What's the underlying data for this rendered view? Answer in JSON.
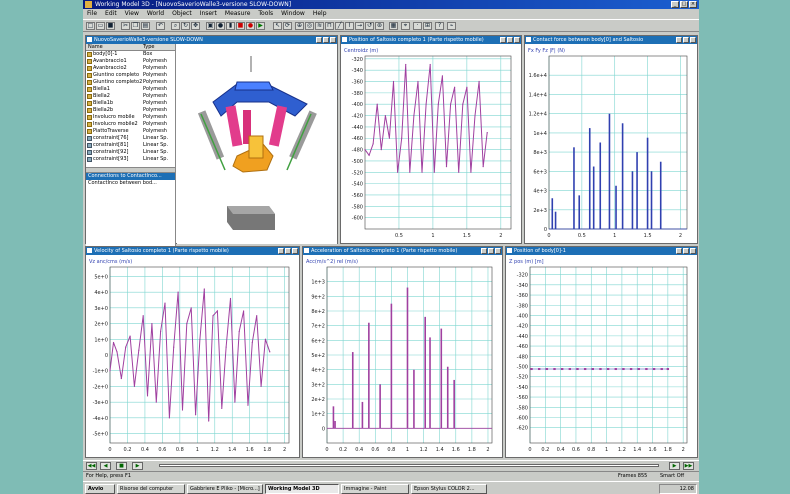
{
  "app": {
    "title": "Working Model 3D - [NuovoSaverioWalle3-versione SLOW-DOWN]",
    "menu": [
      "File",
      "Edit",
      "View",
      "World",
      "Object",
      "Insert",
      "Measure",
      "Tools",
      "Window",
      "Help"
    ]
  },
  "tree_window": {
    "title": "NuovoSaverioWalle3-versione SLOW-DOWN",
    "col_name": "Name",
    "col_type": "Type",
    "items": [
      {
        "name": "body[0]-1",
        "type": "Box"
      },
      {
        "name": "Avanbraccio1",
        "type": "Polymesh"
      },
      {
        "name": "Avanbraccio2",
        "type": "Polymesh"
      },
      {
        "name": "Giuntino completo",
        "type": "Polymesh"
      },
      {
        "name": "Giuntino completo2",
        "type": "Polymesh"
      },
      {
        "name": "Biella1",
        "type": "Polymesh"
      },
      {
        "name": "Biella2",
        "type": "Polymesh"
      },
      {
        "name": "Biella1b",
        "type": "Polymesh"
      },
      {
        "name": "Biella2b",
        "type": "Polymesh"
      },
      {
        "name": "Involucro mobile",
        "type": "Polymesh"
      },
      {
        "name": "Involucro mobile2",
        "type": "Polymesh"
      },
      {
        "name": "PiattoTraverse",
        "type": "Polymesh"
      },
      {
        "name": "constraint[76]",
        "type": "Linear Sp."
      },
      {
        "name": "constraint[81]",
        "type": "Linear Sp."
      },
      {
        "name": "constraint[92]",
        "type": "Linear Sp."
      },
      {
        "name": "constraint[93]",
        "type": "Linear Sp."
      }
    ],
    "sub_title": "Connections to ContactInco...",
    "sub_item": "ContactInco between bod..."
  },
  "status": {
    "left": "For Help, press F1",
    "frames": "Frames 855",
    "smart": "Smart Off"
  },
  "taskbar": {
    "items": [
      {
        "label": "Avvio",
        "active": false,
        "start": true
      },
      {
        "label": "Risorse del computer",
        "active": false
      },
      {
        "label": "Gabbriere E Pliko - [Micro...]",
        "active": false
      },
      {
        "label": "Working Model 3D",
        "active": true
      },
      {
        "label": "Immagine - Paint",
        "active": false
      },
      {
        "label": "Epson Stylus COLOR 2...",
        "active": false
      }
    ],
    "clock": "12.08"
  },
  "chart_data": [
    {
      "type": "line",
      "title": "Position of Saltosio completo 1 (Parte rispetto mobile)",
      "ylabel": "Centroidz (m)",
      "color": "#a040a0",
      "ylim": [
        -0.62,
        -0.315
      ],
      "yticks": [
        -0.32,
        -0.34,
        -0.36,
        -0.38,
        -0.4,
        -0.42,
        -0.44,
        -0.46,
        -0.48,
        -0.5,
        -0.52,
        -0.54,
        -0.56,
        -0.58,
        -0.6
      ],
      "yticklabels": [
        "-320",
        "-340",
        "-360",
        "-380",
        "-400",
        "-420",
        "-440",
        "-460",
        "-480",
        "-500",
        "-520",
        "-540",
        "-560",
        "-580",
        "-600"
      ],
      "xlim": [
        0,
        2.15
      ],
      "xticks": [
        0.5,
        1.0,
        1.5,
        2.0
      ],
      "xticklabels": [
        "0.5",
        "1",
        "1.5",
        "2"
      ],
      "x": [
        0,
        0.06,
        0.12,
        0.18,
        0.24,
        0.3,
        0.36,
        0.42,
        0.48,
        0.54,
        0.6,
        0.66,
        0.72,
        0.78,
        0.84,
        0.9,
        0.96,
        1.02,
        1.08,
        1.14,
        1.2,
        1.26,
        1.32,
        1.38,
        1.44,
        1.5,
        1.56,
        1.62,
        1.68,
        1.74,
        1.8
      ],
      "y": [
        -0.48,
        -0.49,
        -0.47,
        -0.4,
        -0.48,
        -0.42,
        -0.46,
        -0.36,
        -0.52,
        -0.46,
        -0.33,
        -0.52,
        -0.42,
        -0.36,
        -0.52,
        -0.4,
        -0.33,
        -0.52,
        -0.4,
        -0.35,
        -0.51,
        -0.4,
        -0.37,
        -0.52,
        -0.4,
        -0.37,
        -0.52,
        -0.42,
        -0.36,
        -0.51,
        -0.45
      ]
    },
    {
      "type": "bar",
      "title": "Contact force between body[0] and Saltosio",
      "ylabel": "Fx  Fy  Fz  |F| (N)",
      "color": "#3040b0",
      "ylim": [
        0,
        18000
      ],
      "yticks": [
        0,
        2000,
        4000,
        6000,
        8000,
        10000,
        12000,
        14000,
        16000
      ],
      "yticklabels": [
        "0",
        "2e+3",
        "4e+3",
        "6e+3",
        "8e+3",
        "1e+4",
        "1.2e+4",
        "1.4e+4",
        "1.6e+4"
      ],
      "xlim": [
        0,
        2.1
      ],
      "xticks": [
        0,
        0.5,
        1.0,
        1.5,
        2.0
      ],
      "xticklabels": [
        "0",
        "0.5",
        "1",
        "1.5",
        "2"
      ],
      "x": [
        0.05,
        0.1,
        0.38,
        0.46,
        0.62,
        0.68,
        0.78,
        0.92,
        1.02,
        1.12,
        1.27,
        1.34,
        1.5,
        1.56,
        1.7
      ],
      "values": [
        3200,
        1800,
        8500,
        3500,
        10500,
        6500,
        9000,
        12000,
        4500,
        11000,
        6000,
        8000,
        9500,
        6000,
        7000
      ]
    },
    {
      "type": "line",
      "title": "Velocity of Saltosio completo 1 (Parte rispetto mobile)",
      "ylabel": "Vz anc/cms (m/s)",
      "color": "#a040a0",
      "ylim": [
        -5.6,
        5.6
      ],
      "yticks": [
        -5,
        -4,
        -3,
        -2,
        -1,
        0,
        1,
        2,
        3,
        4,
        5
      ],
      "yticklabels": [
        "-5e+0",
        "-4e+0",
        "-3e+0",
        "-2e+0",
        "-1e+0",
        "0",
        "1e+0",
        "2e+0",
        "3e+0",
        "4e+0",
        "5e+0"
      ],
      "xlim": [
        0,
        2.05
      ],
      "xticks": [
        0,
        0.2,
        0.4,
        0.6,
        0.8,
        1.0,
        1.2,
        1.4,
        1.6,
        1.8,
        2.0
      ],
      "xticklabels": [
        "0",
        "0.2",
        "0.4",
        "0.6",
        "0.8",
        "1",
        "1.2",
        "1.4",
        "1.6",
        "1.8",
        "2"
      ],
      "x": [
        0,
        0.04,
        0.08,
        0.13,
        0.18,
        0.23,
        0.28,
        0.33,
        0.38,
        0.43,
        0.48,
        0.53,
        0.58,
        0.63,
        0.68,
        0.73,
        0.78,
        0.83,
        0.88,
        0.93,
        0.98,
        1.03,
        1.08,
        1.13,
        1.18,
        1.23,
        1.28,
        1.33,
        1.38,
        1.43,
        1.48,
        1.53,
        1.58,
        1.63,
        1.68,
        1.73,
        1.78,
        1.83
      ],
      "y": [
        -1.0,
        0.8,
        0.2,
        -1.5,
        0.5,
        1.2,
        -2.0,
        0.3,
        2.5,
        -2.6,
        2.0,
        -3.0,
        1.5,
        3.3,
        -4.0,
        0.5,
        4.0,
        -3.5,
        2.0,
        3.0,
        -3.8,
        1.0,
        4.2,
        -4.2,
        2.5,
        2.8,
        -3.4,
        0.5,
        3.6,
        -3.0,
        1.5,
        2.8,
        -3.2,
        0.8,
        2.5,
        -2.0,
        1.0,
        0.2
      ]
    },
    {
      "type": "bar",
      "title": "Acceleration of Saltosio completo 1 (Parte rispetto mobile)",
      "ylabel": "Acc(m/s^2) rel (m/s)",
      "color": "#a040a0",
      "ylim": [
        -100,
        1100
      ],
      "yticks": [
        0,
        100,
        200,
        300,
        400,
        500,
        600,
        700,
        800,
        900,
        1000
      ],
      "yticklabels": [
        "0",
        "1e+2",
        "2e+2",
        "3e+2",
        "4e+2",
        "5e+2",
        "6e+2",
        "7e+2",
        "8e+2",
        "9e+2",
        "1e+3"
      ],
      "xlim": [
        0,
        2.05
      ],
      "xticks": [
        0,
        0.2,
        0.4,
        0.6,
        0.8,
        1.0,
        1.2,
        1.4,
        1.6,
        1.8,
        2.0
      ],
      "xticklabels": [
        "0",
        "0.2",
        "0.4",
        "0.6",
        "0.8",
        "1",
        "1.2",
        "1.4",
        "1.6",
        "1.8",
        "2"
      ],
      "x": [
        0.08,
        0.1,
        0.32,
        0.44,
        0.52,
        0.66,
        0.8,
        1.0,
        1.08,
        1.22,
        1.28,
        1.42,
        1.5,
        1.58
      ],
      "values": [
        150,
        50,
        520,
        180,
        720,
        300,
        850,
        960,
        400,
        760,
        620,
        680,
        420,
        330
      ]
    },
    {
      "type": "scatter",
      "title": "Position of body[0]-1",
      "ylabel": "Z pos (m) [m]",
      "color": "#3040b0",
      "ylim": [
        -0.65,
        -0.305
      ],
      "yticks": [
        -0.32,
        -0.34,
        -0.36,
        -0.38,
        -0.4,
        -0.42,
        -0.44,
        -0.46,
        -0.48,
        -0.5,
        -0.52,
        -0.54,
        -0.56,
        -0.58,
        -0.6,
        -0.62
      ],
      "yticklabels": [
        "-320",
        "-340",
        "-360",
        "-380",
        "-400",
        "-420",
        "-440",
        "-460",
        "-480",
        "-500",
        "-520",
        "-540",
        "-560",
        "-580",
        "-600",
        "-620"
      ],
      "xlim": [
        0,
        2.05
      ],
      "xticks": [
        0,
        0.2,
        0.4,
        0.6,
        0.8,
        1.0,
        1.2,
        1.4,
        1.6,
        1.8,
        2.0
      ],
      "xticklabels": [
        "0",
        "0.2",
        "0.4",
        "0.6",
        "0.8",
        "1",
        "1.2",
        "1.4",
        "1.6",
        "1.8",
        "2"
      ],
      "x": [
        0.02,
        0.12,
        0.22,
        0.32,
        0.42,
        0.52,
        0.62,
        0.72,
        0.82,
        0.92,
        1.02,
        1.12,
        1.22,
        1.32,
        1.42,
        1.52,
        1.62,
        1.72,
        1.8
      ],
      "y": [
        -0.505,
        -0.505,
        -0.505,
        -0.505,
        -0.505,
        -0.505,
        -0.505,
        -0.505,
        -0.505,
        -0.505,
        -0.505,
        -0.505,
        -0.505,
        -0.505,
        -0.505,
        -0.505,
        -0.505,
        -0.505,
        -0.505
      ]
    }
  ]
}
